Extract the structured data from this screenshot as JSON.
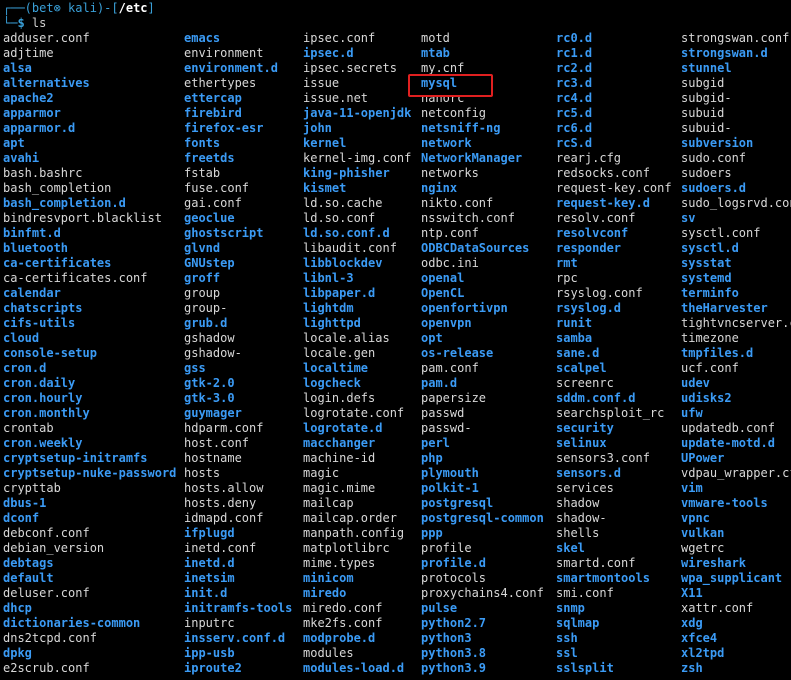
{
  "prompt": {
    "open": "┌──(",
    "user": "bet⊗ kali",
    "mid": ")-[",
    "path": "/etc",
    "close": "]",
    "corner": "└─",
    "dollar": "$ ",
    "command": "ls"
  },
  "colors": {
    "directory": "#3b9bf5",
    "file": "#d8d8d8",
    "prompt": "#3aa0d8",
    "highlight": "#e02020",
    "background": "#000000"
  },
  "highlighted_entry": "mysql",
  "columns": [
    {
      "entries": [
        {
          "name": "adduser.conf",
          "dir": false
        },
        {
          "name": "adjtime",
          "dir": false
        },
        {
          "name": "alsa",
          "dir": true
        },
        {
          "name": "alternatives",
          "dir": true
        },
        {
          "name": "apache2",
          "dir": true
        },
        {
          "name": "apparmor",
          "dir": true
        },
        {
          "name": "apparmor.d",
          "dir": true
        },
        {
          "name": "apt",
          "dir": true
        },
        {
          "name": "avahi",
          "dir": true
        },
        {
          "name": "bash.bashrc",
          "dir": false
        },
        {
          "name": "bash_completion",
          "dir": false
        },
        {
          "name": "bash_completion.d",
          "dir": true
        },
        {
          "name": "bindresvport.blacklist",
          "dir": false
        },
        {
          "name": "binfmt.d",
          "dir": true
        },
        {
          "name": "bluetooth",
          "dir": true
        },
        {
          "name": "ca-certificates",
          "dir": true
        },
        {
          "name": "ca-certificates.conf",
          "dir": false
        },
        {
          "name": "calendar",
          "dir": true
        },
        {
          "name": "chatscripts",
          "dir": true
        },
        {
          "name": "cifs-utils",
          "dir": true
        },
        {
          "name": "cloud",
          "dir": true
        },
        {
          "name": "console-setup",
          "dir": true
        },
        {
          "name": "cron.d",
          "dir": true
        },
        {
          "name": "cron.daily",
          "dir": true
        },
        {
          "name": "cron.hourly",
          "dir": true
        },
        {
          "name": "cron.monthly",
          "dir": true
        },
        {
          "name": "crontab",
          "dir": false
        },
        {
          "name": "cron.weekly",
          "dir": true
        },
        {
          "name": "cryptsetup-initramfs",
          "dir": true
        },
        {
          "name": "cryptsetup-nuke-password",
          "dir": true
        },
        {
          "name": "crypttab",
          "dir": false
        },
        {
          "name": "dbus-1",
          "dir": true
        },
        {
          "name": "dconf",
          "dir": true
        },
        {
          "name": "debconf.conf",
          "dir": false
        },
        {
          "name": "debian_version",
          "dir": false
        },
        {
          "name": "debtags",
          "dir": true
        },
        {
          "name": "default",
          "dir": true
        },
        {
          "name": "deluser.conf",
          "dir": false
        },
        {
          "name": "dhcp",
          "dir": true
        },
        {
          "name": "dictionaries-common",
          "dir": true
        },
        {
          "name": "dns2tcpd.conf",
          "dir": false
        },
        {
          "name": "dpkg",
          "dir": true
        },
        {
          "name": "e2scrub.conf",
          "dir": false
        }
      ]
    },
    {
      "entries": [
        {
          "name": "emacs",
          "dir": true
        },
        {
          "name": "environment",
          "dir": false
        },
        {
          "name": "environment.d",
          "dir": true
        },
        {
          "name": "ethertypes",
          "dir": false
        },
        {
          "name": "ettercap",
          "dir": true
        },
        {
          "name": "firebird",
          "dir": true
        },
        {
          "name": "firefox-esr",
          "dir": true
        },
        {
          "name": "fonts",
          "dir": true
        },
        {
          "name": "freetds",
          "dir": true
        },
        {
          "name": "fstab",
          "dir": false
        },
        {
          "name": "fuse.conf",
          "dir": false
        },
        {
          "name": "gai.conf",
          "dir": false
        },
        {
          "name": "geoclue",
          "dir": true
        },
        {
          "name": "ghostscript",
          "dir": true
        },
        {
          "name": "glvnd",
          "dir": true
        },
        {
          "name": "GNUstep",
          "dir": true
        },
        {
          "name": "groff",
          "dir": true
        },
        {
          "name": "group",
          "dir": false
        },
        {
          "name": "group-",
          "dir": false
        },
        {
          "name": "grub.d",
          "dir": true
        },
        {
          "name": "gshadow",
          "dir": false
        },
        {
          "name": "gshadow-",
          "dir": false
        },
        {
          "name": "gss",
          "dir": true
        },
        {
          "name": "gtk-2.0",
          "dir": true
        },
        {
          "name": "gtk-3.0",
          "dir": true
        },
        {
          "name": "guymager",
          "dir": true
        },
        {
          "name": "hdparm.conf",
          "dir": false
        },
        {
          "name": "host.conf",
          "dir": false
        },
        {
          "name": "hostname",
          "dir": false
        },
        {
          "name": "hosts",
          "dir": false
        },
        {
          "name": "hosts.allow",
          "dir": false
        },
        {
          "name": "hosts.deny",
          "dir": false
        },
        {
          "name": "idmapd.conf",
          "dir": false
        },
        {
          "name": "ifplugd",
          "dir": true
        },
        {
          "name": "inetd.conf",
          "dir": false
        },
        {
          "name": "inetd.d",
          "dir": true
        },
        {
          "name": "inetsim",
          "dir": true
        },
        {
          "name": "init.d",
          "dir": true
        },
        {
          "name": "initramfs-tools",
          "dir": true
        },
        {
          "name": "inputrc",
          "dir": false
        },
        {
          "name": "insserv.conf.d",
          "dir": true
        },
        {
          "name": "ipp-usb",
          "dir": true
        },
        {
          "name": "iproute2",
          "dir": true
        }
      ]
    },
    {
      "entries": [
        {
          "name": "ipsec.conf",
          "dir": false
        },
        {
          "name": "ipsec.d",
          "dir": true
        },
        {
          "name": "ipsec.secrets",
          "dir": false
        },
        {
          "name": "issue",
          "dir": false
        },
        {
          "name": "issue.net",
          "dir": false
        },
        {
          "name": "java-11-openjdk",
          "dir": true
        },
        {
          "name": "john",
          "dir": true
        },
        {
          "name": "kernel",
          "dir": true
        },
        {
          "name": "kernel-img.conf",
          "dir": false
        },
        {
          "name": "king-phisher",
          "dir": true
        },
        {
          "name": "kismet",
          "dir": true
        },
        {
          "name": "ld.so.cache",
          "dir": false
        },
        {
          "name": "ld.so.conf",
          "dir": false
        },
        {
          "name": "ld.so.conf.d",
          "dir": true
        },
        {
          "name": "libaudit.conf",
          "dir": false
        },
        {
          "name": "libblockdev",
          "dir": true
        },
        {
          "name": "libnl-3",
          "dir": true
        },
        {
          "name": "libpaper.d",
          "dir": true
        },
        {
          "name": "lightdm",
          "dir": true
        },
        {
          "name": "lighttpd",
          "dir": true
        },
        {
          "name": "locale.alias",
          "dir": false
        },
        {
          "name": "locale.gen",
          "dir": false
        },
        {
          "name": "localtime",
          "dir": true
        },
        {
          "name": "logcheck",
          "dir": true
        },
        {
          "name": "login.defs",
          "dir": false
        },
        {
          "name": "logrotate.conf",
          "dir": false
        },
        {
          "name": "logrotate.d",
          "dir": true
        },
        {
          "name": "macchanger",
          "dir": true
        },
        {
          "name": "machine-id",
          "dir": false
        },
        {
          "name": "magic",
          "dir": false
        },
        {
          "name": "magic.mime",
          "dir": false
        },
        {
          "name": "mailcap",
          "dir": false
        },
        {
          "name": "mailcap.order",
          "dir": false
        },
        {
          "name": "manpath.config",
          "dir": false
        },
        {
          "name": "matplotlibrc",
          "dir": false
        },
        {
          "name": "mime.types",
          "dir": false
        },
        {
          "name": "minicom",
          "dir": true
        },
        {
          "name": "miredo",
          "dir": true
        },
        {
          "name": "miredo.conf",
          "dir": false
        },
        {
          "name": "mke2fs.conf",
          "dir": false
        },
        {
          "name": "modprobe.d",
          "dir": true
        },
        {
          "name": "modules",
          "dir": false
        },
        {
          "name": "modules-load.d",
          "dir": true
        }
      ]
    },
    {
      "entries": [
        {
          "name": "motd",
          "dir": false
        },
        {
          "name": "mtab",
          "dir": true
        },
        {
          "name": "my.cnf",
          "dir": false
        },
        {
          "name": "mysql",
          "dir": true
        },
        {
          "name": "nanorc",
          "dir": false
        },
        {
          "name": "netconfig",
          "dir": false
        },
        {
          "name": "netsniff-ng",
          "dir": true
        },
        {
          "name": "network",
          "dir": true
        },
        {
          "name": "NetworkManager",
          "dir": true
        },
        {
          "name": "networks",
          "dir": false
        },
        {
          "name": "nginx",
          "dir": true
        },
        {
          "name": "nikto.conf",
          "dir": false
        },
        {
          "name": "nsswitch.conf",
          "dir": false
        },
        {
          "name": "ntp.conf",
          "dir": false
        },
        {
          "name": "ODBCDataSources",
          "dir": true
        },
        {
          "name": "odbc.ini",
          "dir": false
        },
        {
          "name": "openal",
          "dir": true
        },
        {
          "name": "OpenCL",
          "dir": true
        },
        {
          "name": "openfortivpn",
          "dir": true
        },
        {
          "name": "openvpn",
          "dir": true
        },
        {
          "name": "opt",
          "dir": true
        },
        {
          "name": "os-release",
          "dir": true
        },
        {
          "name": "pam.conf",
          "dir": false
        },
        {
          "name": "pam.d",
          "dir": true
        },
        {
          "name": "papersize",
          "dir": false
        },
        {
          "name": "passwd",
          "dir": false
        },
        {
          "name": "passwd-",
          "dir": false
        },
        {
          "name": "perl",
          "dir": true
        },
        {
          "name": "php",
          "dir": true
        },
        {
          "name": "plymouth",
          "dir": true
        },
        {
          "name": "polkit-1",
          "dir": true
        },
        {
          "name": "postgresql",
          "dir": true
        },
        {
          "name": "postgresql-common",
          "dir": true
        },
        {
          "name": "ppp",
          "dir": true
        },
        {
          "name": "profile",
          "dir": false
        },
        {
          "name": "profile.d",
          "dir": true
        },
        {
          "name": "protocols",
          "dir": false
        },
        {
          "name": "proxychains4.conf",
          "dir": false
        },
        {
          "name": "pulse",
          "dir": true
        },
        {
          "name": "python2.7",
          "dir": true
        },
        {
          "name": "python3",
          "dir": true
        },
        {
          "name": "python3.8",
          "dir": true
        },
        {
          "name": "python3.9",
          "dir": true
        }
      ]
    },
    {
      "entries": [
        {
          "name": "rc0.d",
          "dir": true
        },
        {
          "name": "rc1.d",
          "dir": true
        },
        {
          "name": "rc2.d",
          "dir": true
        },
        {
          "name": "rc3.d",
          "dir": true
        },
        {
          "name": "rc4.d",
          "dir": true
        },
        {
          "name": "rc5.d",
          "dir": true
        },
        {
          "name": "rc6.d",
          "dir": true
        },
        {
          "name": "rcS.d",
          "dir": true
        },
        {
          "name": "rearj.cfg",
          "dir": false
        },
        {
          "name": "redsocks.conf",
          "dir": false
        },
        {
          "name": "request-key.conf",
          "dir": false
        },
        {
          "name": "request-key.d",
          "dir": true
        },
        {
          "name": "resolv.conf",
          "dir": false
        },
        {
          "name": "resolvconf",
          "dir": true
        },
        {
          "name": "responder",
          "dir": true
        },
        {
          "name": "rmt",
          "dir": true
        },
        {
          "name": "rpc",
          "dir": false
        },
        {
          "name": "rsyslog.conf",
          "dir": false
        },
        {
          "name": "rsyslog.d",
          "dir": true
        },
        {
          "name": "runit",
          "dir": true
        },
        {
          "name": "samba",
          "dir": true
        },
        {
          "name": "sane.d",
          "dir": true
        },
        {
          "name": "scalpel",
          "dir": true
        },
        {
          "name": "screenrc",
          "dir": false
        },
        {
          "name": "sddm.conf.d",
          "dir": true
        },
        {
          "name": "searchsploit_rc",
          "dir": false
        },
        {
          "name": "security",
          "dir": true
        },
        {
          "name": "selinux",
          "dir": true
        },
        {
          "name": "sensors3.conf",
          "dir": false
        },
        {
          "name": "sensors.d",
          "dir": true
        },
        {
          "name": "services",
          "dir": false
        },
        {
          "name": "shadow",
          "dir": false
        },
        {
          "name": "shadow-",
          "dir": false
        },
        {
          "name": "shells",
          "dir": false
        },
        {
          "name": "skel",
          "dir": true
        },
        {
          "name": "smartd.conf",
          "dir": false
        },
        {
          "name": "smartmontools",
          "dir": true
        },
        {
          "name": "smi.conf",
          "dir": false
        },
        {
          "name": "snmp",
          "dir": true
        },
        {
          "name": "sqlmap",
          "dir": true
        },
        {
          "name": "ssh",
          "dir": true
        },
        {
          "name": "ssl",
          "dir": true
        },
        {
          "name": "sslsplit",
          "dir": true
        }
      ]
    },
    {
      "entries": [
        {
          "name": "strongswan.conf",
          "dir": false
        },
        {
          "name": "strongswan.d",
          "dir": true
        },
        {
          "name": "stunnel",
          "dir": true
        },
        {
          "name": "subgid",
          "dir": false
        },
        {
          "name": "subgid-",
          "dir": false
        },
        {
          "name": "subuid",
          "dir": false
        },
        {
          "name": "subuid-",
          "dir": false
        },
        {
          "name": "subversion",
          "dir": true
        },
        {
          "name": "sudo.conf",
          "dir": false
        },
        {
          "name": "sudoers",
          "dir": false
        },
        {
          "name": "sudoers.d",
          "dir": true
        },
        {
          "name": "sudo_logsrvd.conf",
          "dir": false
        },
        {
          "name": "sv",
          "dir": true
        },
        {
          "name": "sysctl.conf",
          "dir": false
        },
        {
          "name": "sysctl.d",
          "dir": true
        },
        {
          "name": "sysstat",
          "dir": true
        },
        {
          "name": "systemd",
          "dir": true
        },
        {
          "name": "terminfo",
          "dir": true
        },
        {
          "name": "theHarvester",
          "dir": true
        },
        {
          "name": "tightvncserver.conf",
          "dir": false
        },
        {
          "name": "timezone",
          "dir": false
        },
        {
          "name": "tmpfiles.d",
          "dir": true
        },
        {
          "name": "ucf.conf",
          "dir": false
        },
        {
          "name": "udev",
          "dir": true
        },
        {
          "name": "udisks2",
          "dir": true
        },
        {
          "name": "ufw",
          "dir": true
        },
        {
          "name": "updatedb.conf",
          "dir": false
        },
        {
          "name": "update-motd.d",
          "dir": true
        },
        {
          "name": "UPower",
          "dir": true
        },
        {
          "name": "vdpau_wrapper.cfg",
          "dir": false
        },
        {
          "name": "vim",
          "dir": true
        },
        {
          "name": "vmware-tools",
          "dir": true
        },
        {
          "name": "vpnc",
          "dir": true
        },
        {
          "name": "vulkan",
          "dir": true
        },
        {
          "name": "wgetrc",
          "dir": false
        },
        {
          "name": "wireshark",
          "dir": true
        },
        {
          "name": "wpa_supplicant",
          "dir": true
        },
        {
          "name": "X11",
          "dir": true
        },
        {
          "name": "xattr.conf",
          "dir": false
        },
        {
          "name": "xdg",
          "dir": true
        },
        {
          "name": "xfce4",
          "dir": true
        },
        {
          "name": "xl2tpd",
          "dir": true
        },
        {
          "name": "zsh",
          "dir": true
        }
      ]
    }
  ]
}
